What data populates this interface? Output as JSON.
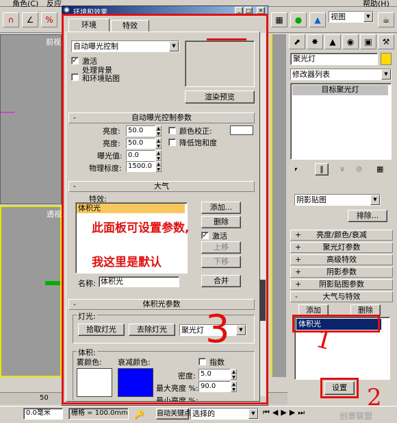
{
  "dialog": {
    "title": "环境和效果",
    "tabs": [
      "环境",
      "特效"
    ],
    "exposure_select": "自动曝光控制",
    "active_label": "激活",
    "process_bg_label": "处理背景\n和环境贴图",
    "render_preview_btn": "渲染预览"
  },
  "auto_exposure": {
    "header": "自动曝光控制参数",
    "brightness_label": "亮度:",
    "brightness_value": "50.0",
    "contrast_label": "亮度:",
    "contrast_value": "50.0",
    "exposure_label": "曝光值:",
    "exposure_value": "0.0",
    "physical_label": "物理标度:",
    "physical_value": "1500.0",
    "color_correction_label": "颜色校正:",
    "desaturate_label": "降低饱和度"
  },
  "atmosphere": {
    "header": "大气",
    "effects_label": "特效:",
    "list_item": "体积光",
    "add_btn": "添加...",
    "delete_btn": "删除",
    "active_label": "激活",
    "move_up_btn": "上移",
    "move_down_btn": "下移",
    "name_label": "名称:",
    "name_value": "体积光",
    "merge_btn": "合并",
    "annotation_line1": "此面板可设置参数,",
    "annotation_line2": "我这里是默认"
  },
  "volume_light": {
    "header": "体积光参数",
    "lights_group": "灯光:",
    "pick_light_btn": "拾取灯光",
    "remove_light_btn": "去除灯光",
    "light_select": "聚光灯",
    "volume_group": "体积:",
    "fog_color_label": "雾颜色:",
    "atten_color_label": "衰减颜色:",
    "exponential_label": "指数",
    "density_label": "密度:",
    "density_value": "5.0",
    "max_brightness_label": "最大亮度 %:",
    "max_brightness_value": "90.0",
    "min_brightness_label": "最小亮度 %:",
    "fog_color": "#ffffff",
    "atten_color": "#0000ff"
  },
  "right_panel": {
    "object_name": "聚光灯",
    "modifier_list": "修改器列表",
    "stack_item": "目标聚光灯",
    "shadow_map_select": "阴影贴图",
    "exclude_btn": "排除...",
    "rollouts": [
      "亮度/颜色/衰减",
      "聚光灯参数",
      "高级特效",
      "阴影参数",
      "阴影贴图参数",
      "大气与特效"
    ],
    "add_btn": "添加",
    "delete_btn": "删除",
    "effects_list_item": "体积光",
    "setup_btn": "设置",
    "annotation_1": "1",
    "annotation_2": "2"
  },
  "annotation_3": "3",
  "main_ui": {
    "menu_items": [
      "角色(C)",
      "反应",
      "帮助(H)"
    ],
    "view_select": "视图",
    "viewport_label_top": "前视",
    "viewport_label_mid": "透视",
    "ruler_value": "50",
    "coord_value": "0.0毫米",
    "grid_label": "栅格 = 100.0mm",
    "autokey_label": "自动关键点",
    "selected_label": "选择的",
    "watermark": "创意联盟"
  }
}
